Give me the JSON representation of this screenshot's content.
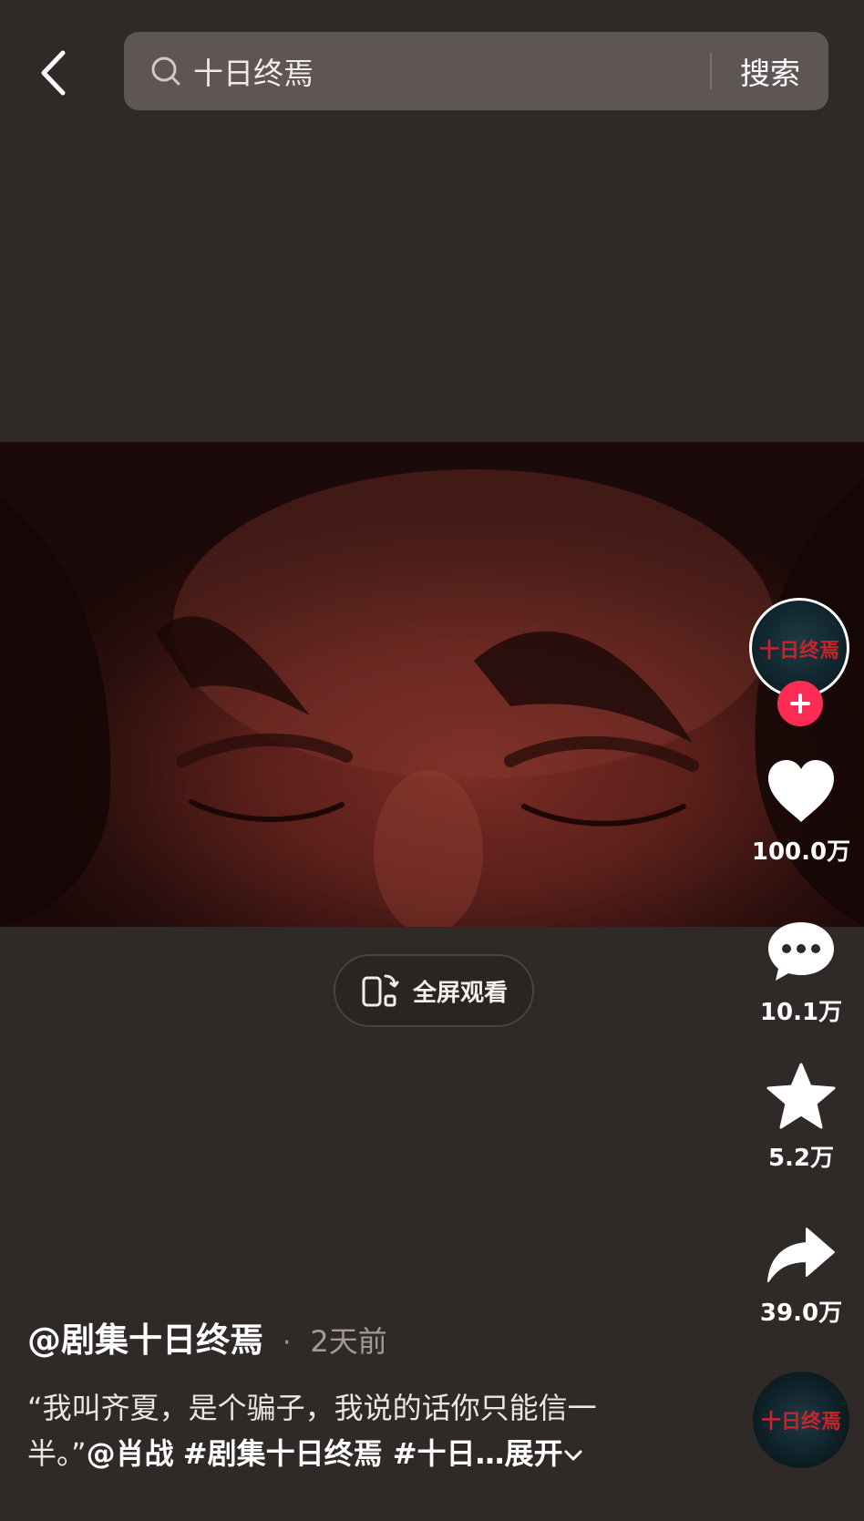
{
  "search": {
    "query": "十日终焉",
    "button_label": "搜索"
  },
  "video": {
    "fullscreen_label": "全屏观看"
  },
  "actions": {
    "likes": "100.0万",
    "comments": "10.1万",
    "favorites": "5.2万",
    "shares": "39.0万"
  },
  "post": {
    "author": "@剧集十日终焉",
    "separator": "·",
    "time": "2天前",
    "caption_text": "“我叫齐夏，是个骗子，我说的话你只能信一半。”",
    "caption_mention": "@肖战",
    "caption_tags": "#剧集十日终焉 #十日…",
    "expand_label": "展开"
  },
  "avatar": {
    "logo_text": "十日终焉"
  },
  "colors": {
    "background": "#2f2927",
    "accent": "#fe2c55",
    "logo_red": "#c8242a"
  },
  "icons": [
    "back-icon",
    "search-icon",
    "phone-rotate-icon",
    "plus-icon",
    "heart-icon",
    "comment-icon",
    "star-icon",
    "share-icon"
  ]
}
